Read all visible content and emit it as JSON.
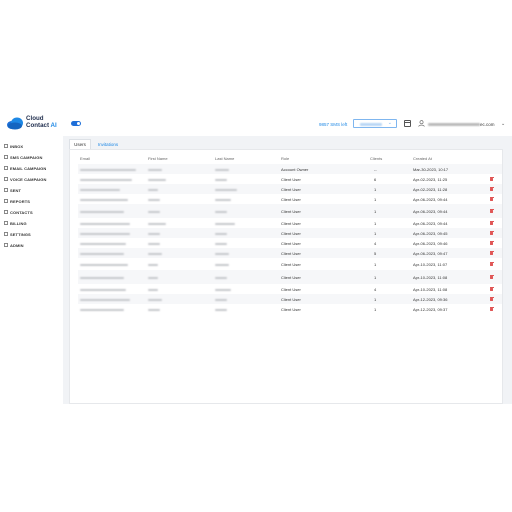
{
  "app": {
    "logo_line1": "Cloud",
    "logo_line2": "Contact",
    "logo_ai": "AI",
    "sms_left": "9857 SMS left",
    "user_email_suffix": "ec.com",
    "accent": "#1e88e5",
    "danger": "#e05656"
  },
  "sidebar": {
    "items": [
      {
        "label": "INBOX",
        "icon": "inbox-icon"
      },
      {
        "label": "SMS CAMPAIGN",
        "icon": "chat-icon"
      },
      {
        "label": "EMAIL CAMPAIGN",
        "icon": "mail-icon"
      },
      {
        "label": "VOICE CAMPAIGN",
        "icon": "phone-icon"
      },
      {
        "label": "SENT",
        "icon": "send-icon"
      },
      {
        "label": "REPORTS",
        "icon": "reports-icon"
      },
      {
        "label": "CONTACTS",
        "icon": "contacts-icon"
      },
      {
        "label": "BILLING",
        "icon": "dollar-icon"
      },
      {
        "label": "SETTINGS",
        "icon": "gear-icon"
      },
      {
        "label": "ADMIN",
        "icon": "admin-icon"
      }
    ]
  },
  "tabs": {
    "users": "Users",
    "invitations": "Invitations"
  },
  "table": {
    "headers": {
      "email": "Email",
      "first": "First Name",
      "last": "Last Name",
      "role": "Role",
      "clients": "Clients",
      "created": "Created At"
    },
    "rows": [
      {
        "role": "Account Owner",
        "clients": "--",
        "created": "Mar-30-2023, 10:17",
        "trash": false
      },
      {
        "role": "Client User",
        "clients": "6",
        "created": "Apr-02-2023, 11:25",
        "trash": true
      },
      {
        "role": "Client User",
        "clients": "1",
        "created": "Apr-02-2023, 11:28",
        "trash": true
      },
      {
        "role": "Client User",
        "clients": "1",
        "created": "Apr-06-2023, 09:44",
        "trash": true
      },
      {
        "role": "Client User",
        "clients": "1",
        "created": "Apr-06-2023, 09:44",
        "trash": true
      },
      {
        "role": "Client User",
        "clients": "1",
        "created": "Apr-06-2023, 09:44",
        "trash": true
      },
      {
        "role": "Client User",
        "clients": "1",
        "created": "Apr-06-2023, 09:45",
        "trash": true
      },
      {
        "role": "Client User",
        "clients": "4",
        "created": "Apr-06-2023, 09:46",
        "trash": true
      },
      {
        "role": "Client User",
        "clients": "5",
        "created": "Apr-06-2023, 09:47",
        "trash": true
      },
      {
        "role": "Client User",
        "clients": "1",
        "created": "Apr-10-2023, 11:07",
        "trash": true
      },
      {
        "role": "Client User",
        "clients": "1",
        "created": "Apr-10-2023, 11:08",
        "trash": true
      },
      {
        "role": "Client User",
        "clients": "4",
        "created": "Apr-10-2023, 11:08",
        "trash": true
      },
      {
        "role": "Client User",
        "clients": "1",
        "created": "Apr-12-2023, 09:36",
        "trash": true
      },
      {
        "role": "Client User",
        "clients": "1",
        "created": "Apr-12-2023, 09:37",
        "trash": true
      }
    ]
  }
}
